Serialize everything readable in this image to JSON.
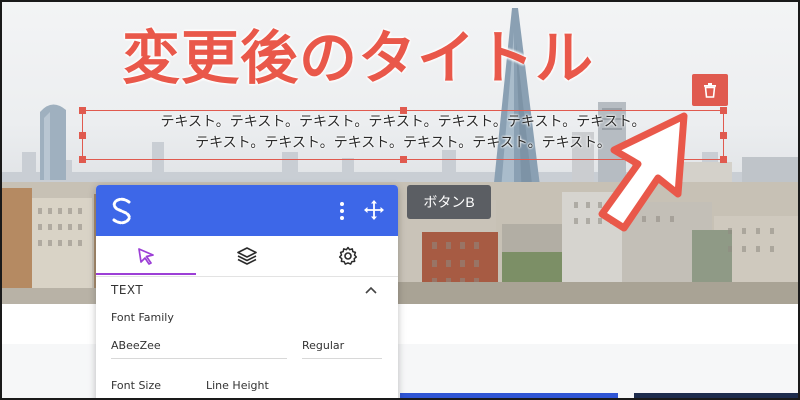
{
  "hero": {
    "title": "変更後のタイトル",
    "body_lines": [
      "テキスト。テキスト。テキスト。テキスト。テキスト。テキスト。テキスト。",
      "テキスト。テキスト。テキスト。テキスト。テキスト。テキスト。"
    ],
    "button_label": "ボタンB"
  },
  "colors": {
    "accent_red": "#e05a4f",
    "title_red": "#e9584a",
    "panel_blue": "#3d67e8",
    "active_tab": "#9c3fd6"
  },
  "panel": {
    "tabs": [
      {
        "icon": "cursor-icon",
        "active": true
      },
      {
        "icon": "layers-icon",
        "active": false
      },
      {
        "icon": "gear-icon",
        "active": false
      }
    ],
    "section": "TEXT",
    "font_family_label": "Font Family",
    "font_family_value": "ABeeZee",
    "font_weight_value": "Regular",
    "font_size_label": "Font Size",
    "line_height_label": "Line Height"
  },
  "icons": [
    "logo-icon",
    "more-vertical-icon",
    "move-icon",
    "trash-icon",
    "chevron-up-icon",
    "pointer-arrow-icon"
  ]
}
